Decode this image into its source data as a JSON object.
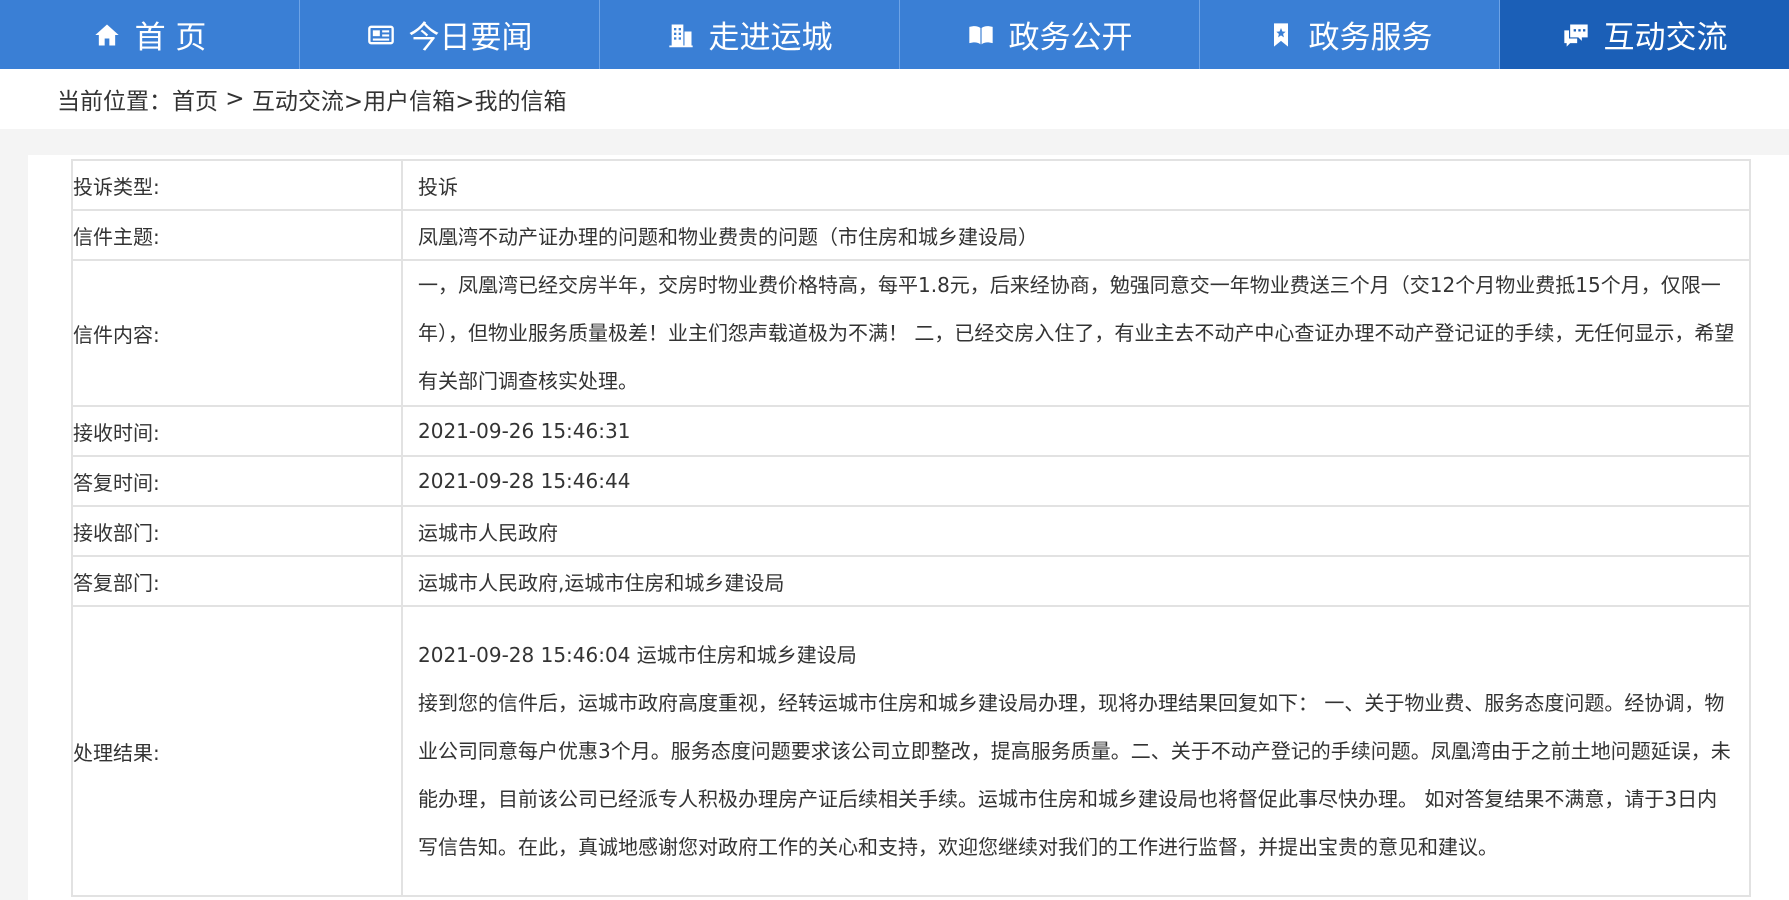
{
  "nav": {
    "items": [
      {
        "label": "首 页",
        "icon": "home-icon",
        "active": false
      },
      {
        "label": "今日要闻",
        "icon": "news-icon",
        "active": false
      },
      {
        "label": "走进运城",
        "icon": "building-icon",
        "active": false
      },
      {
        "label": "政务公开",
        "icon": "book-icon",
        "active": false
      },
      {
        "label": "政务服务",
        "icon": "bookmark-icon",
        "active": false
      },
      {
        "label": "互动交流",
        "icon": "chat-icon",
        "active": true
      }
    ]
  },
  "breadcrumb": {
    "prefix": "当前位置：",
    "home": "首页",
    "sep1": " > ",
    "level1": "互动交流",
    "level2": ">用户信箱",
    "level3": ">我的信箱"
  },
  "letter": {
    "type_label": "投诉类型:",
    "type_value": "投诉",
    "subject_label": "信件主题:",
    "subject_value": "凤凰湾不动产证办理的问题和物业费贵的问题（市住房和城乡建设局）",
    "content_label": "信件内容:",
    "content_value": "一，凤凰湾已经交房半年，交房时物业费价格特高，每平1.8元，后来经协商，勉强同意交一年物业费送三个月（交12个月物业费抵15个月，仅限一年），但物业服务质量极差！业主们怨声载道极为不满！ 二，已经交房入住了，有业主去不动产中心查证办理不动产登记证的手续，无任何显示，希望有关部门调查核实处理。",
    "received_label": "接收时间:",
    "received_value": "2021-09-26 15:46:31",
    "replied_label": "答复时间:",
    "replied_value": "2021-09-28 15:46:44",
    "recv_dept_label": "接收部门:",
    "recv_dept_value": "运城市人民政府",
    "reply_dept_label": "答复部门:",
    "reply_dept_value": "运城市人民政府,运城市住房和城乡建设局",
    "result_label": "处理结果:",
    "result_header": "2021-09-28 15:46:04 运城市住房和城乡建设局",
    "result_body": "接到您的信件后，运城市政府高度重视，经转运城市住房和城乡建设局办理，现将办理结果回复如下： 一、关于物业费、服务态度问题。经协调，物业公司同意每户优惠3个月。服务态度问题要求该公司立即整改，提高服务质量。二、关于不动产登记的手续问题。凤凰湾由于之前土地问题延误，未能办理，目前该公司已经派专人积极办理房产证后续相关手续。运城市住房和城乡建设局也将督促此事尽快办理。 如对答复结果不满意，请于3日内写信告知。在此，真诚地感谢您对政府工作的关心和支持，欢迎您继续对我们的工作进行监督，并提出宝贵的意见和建议。"
  },
  "colors": {
    "nav_bg": "#3a7fd5",
    "nav_active": "#1b5fb7",
    "border": "#e2e2e2"
  }
}
